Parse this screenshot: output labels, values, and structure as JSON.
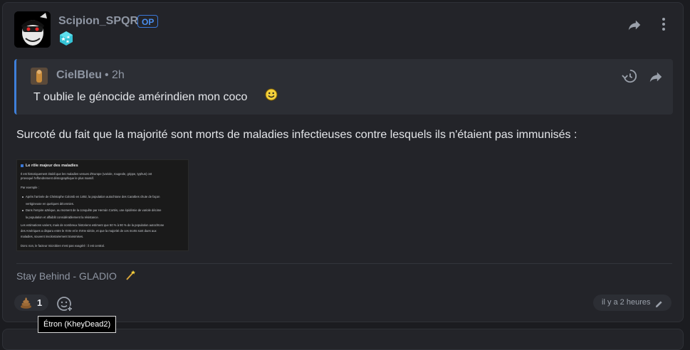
{
  "post": {
    "username": "Scipion_SPQR",
    "op_badge": "OP",
    "quote": {
      "username": "CielBleu",
      "separator": "•",
      "time": "2h",
      "text": "T oublie le génocide amérindien mon coco"
    },
    "body": "Surcoté du fait que la majorité sont morts de maladies infectieuses contre lesquels ils n'étaient pas immunisés :",
    "embedded_image": {
      "title": "Le rôle majeur des maladies",
      "p1": "Il est historiquement établi que les maladies venues d'Europe (variole, rougeole, grippe, typhus) ont",
      "p1b": "provoqué l'effondrement démographique le plus massif.",
      "example": "Par exemple :",
      "li1": "Après l'arrivée de Christophe Colomb en 1492, la population autochtone des Caraïbes chute de façon",
      "li1b": "vertigineuse en quelques décennies.",
      "li2": "Dans l'empire aztèque, au moment de la conquête par Hernán Cortés, une épidémie de variole décime",
      "li2b": "la population et affaiblit considérablement la résistance.",
      "p2": "Les estimations varient, mais de nombreux historiens estiment que 50 % à 90 % de la population autochtone",
      "p2b": "des Amériques a disparu entre le XVIe et le XVIIe siècle, et que la majorité de ces morts sont dues aux",
      "p2c": "maladies, souvent involontairement transmises.",
      "p3": "Donc non, le facteur microbien n'est pas exagéré : il est central."
    },
    "signature": "Stay Behind - GLADIO",
    "reaction": {
      "emoji": "poop-emoji",
      "count": "1"
    },
    "timestamp": "il y a 2 heures",
    "tooltip": "Étron (KheyDead2)"
  },
  "colors": {
    "background": "#1b1c20",
    "card": "#232429",
    "quote_bg": "#2c2e34",
    "accent": "#3e7fd9",
    "muted": "#8f96a3"
  }
}
